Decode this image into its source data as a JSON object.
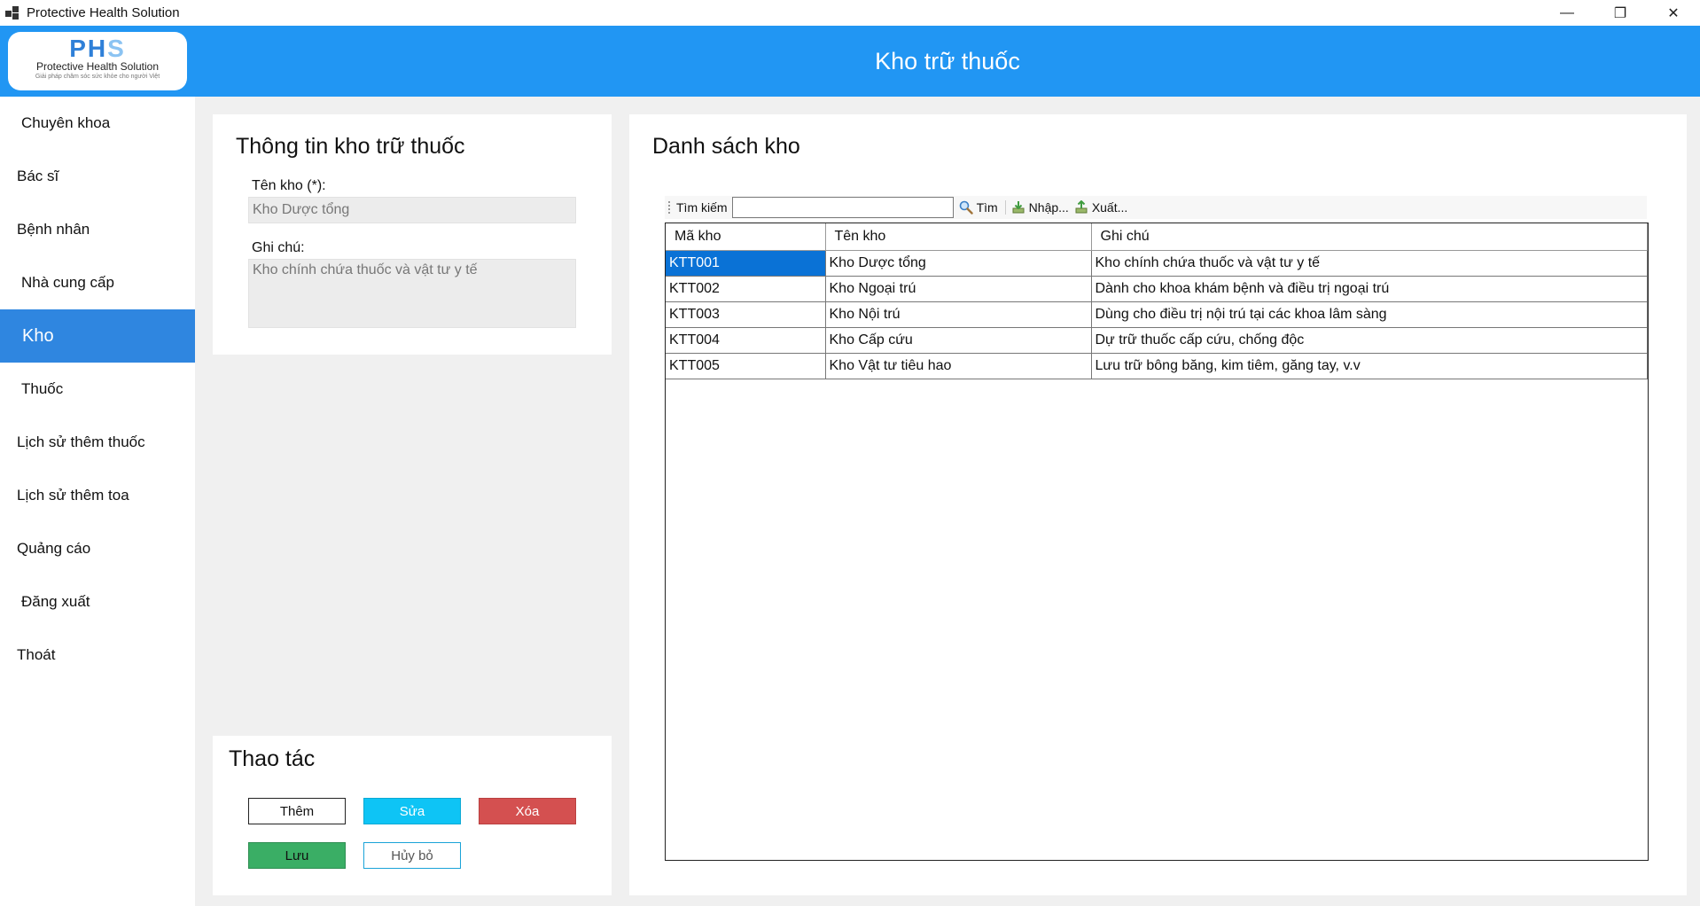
{
  "window": {
    "title": "Protective Health Solution",
    "controls": {
      "minimize": "—",
      "restore": "❐",
      "close": "✕"
    }
  },
  "logo": {
    "mark_1": "PH",
    "mark_2": "S",
    "name": "Protective Health Solution",
    "tagline": "Giải pháp chăm sóc sức khỏe cho người Việt"
  },
  "header": {
    "title": "Kho trữ thuốc"
  },
  "sidebar": {
    "items": [
      {
        "label": "Chuyên khoa",
        "active": false
      },
      {
        "label": "Bác sĩ",
        "active": false
      },
      {
        "label": "Bệnh nhân",
        "active": false
      },
      {
        "label": "Nhà cung cấp",
        "active": false
      },
      {
        "label": "Kho",
        "active": true
      },
      {
        "label": "Thuốc",
        "active": false
      },
      {
        "label": "Lịch sử thêm thuốc",
        "active": false
      },
      {
        "label": "Lịch sử thêm toa",
        "active": false
      },
      {
        "label": "Quảng cáo",
        "active": false
      },
      {
        "label": "Đăng xuất",
        "active": false
      },
      {
        "label": "Thoát",
        "active": false
      }
    ]
  },
  "info": {
    "title": "Thông tin kho trữ thuốc",
    "name_label": "Tên kho (*):",
    "name_value": "Kho Dược tổng",
    "note_label": "Ghi chú:",
    "note_value": "Kho chính chứa thuốc và vật tư y tế"
  },
  "actions": {
    "title": "Thao tác",
    "add": "Thêm",
    "edit": "Sửa",
    "delete": "Xóa",
    "save": "Lưu",
    "cancel": "Hủy bỏ"
  },
  "list": {
    "title": "Danh sách kho",
    "toolbar": {
      "search_label": "Tìm kiếm",
      "search_value": "",
      "find": "Tìm",
      "import": "Nhập...",
      "export": "Xuất..."
    },
    "columns": [
      "Mã kho",
      "Tên kho",
      "Ghi chú"
    ],
    "rows": [
      [
        "KTT001",
        "Kho Dược tổng",
        "Kho chính chứa thuốc và vật tư y tế"
      ],
      [
        "KTT002",
        "Kho Ngoại trú",
        "Dành cho khoa khám bệnh và điều trị ngoại trú"
      ],
      [
        "KTT003",
        "Kho Nội trú",
        "Dùng cho điều trị nội trú tại các khoa lâm sàng"
      ],
      [
        "KTT004",
        "Kho Cấp cứu",
        "Dự trữ thuốc cấp cứu, chống độc"
      ],
      [
        "KTT005",
        "Kho Vật tư tiêu hao",
        "Lưu trữ bông băng, kim tiêm, găng tay, v.v"
      ]
    ],
    "selected_row": 0
  },
  "colors": {
    "accent": "#2196f3",
    "nav_active": "#2f86e0",
    "edit": "#0ec4f5",
    "delete": "#d45050",
    "save": "#3aae65",
    "selection": "#0a72d6"
  }
}
